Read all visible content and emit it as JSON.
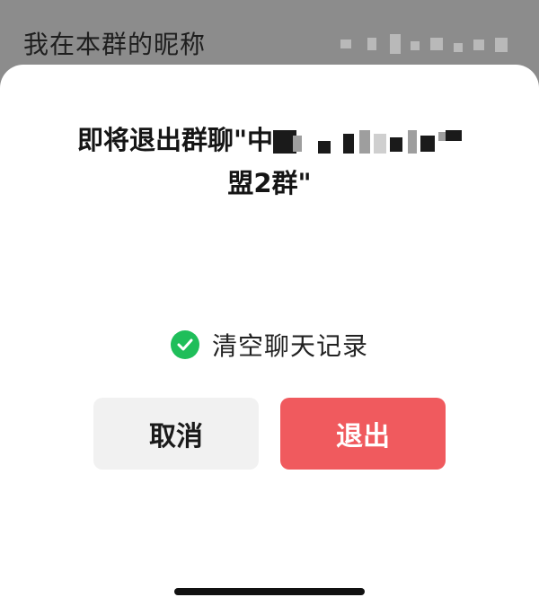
{
  "background_row": {
    "label": "我在本群的昵称"
  },
  "dialog": {
    "title_line1": "即将退出群聊\"中",
    "title_line2": "盟2群\"",
    "option_label": "清空聊天记录",
    "option_checked": true,
    "cancel_label": "取消",
    "exit_label": "退出"
  },
  "colors": {
    "exit_button": "#f05a5e",
    "check_icon": "#1fbe5a",
    "cancel_button": "#f1f1f1"
  }
}
